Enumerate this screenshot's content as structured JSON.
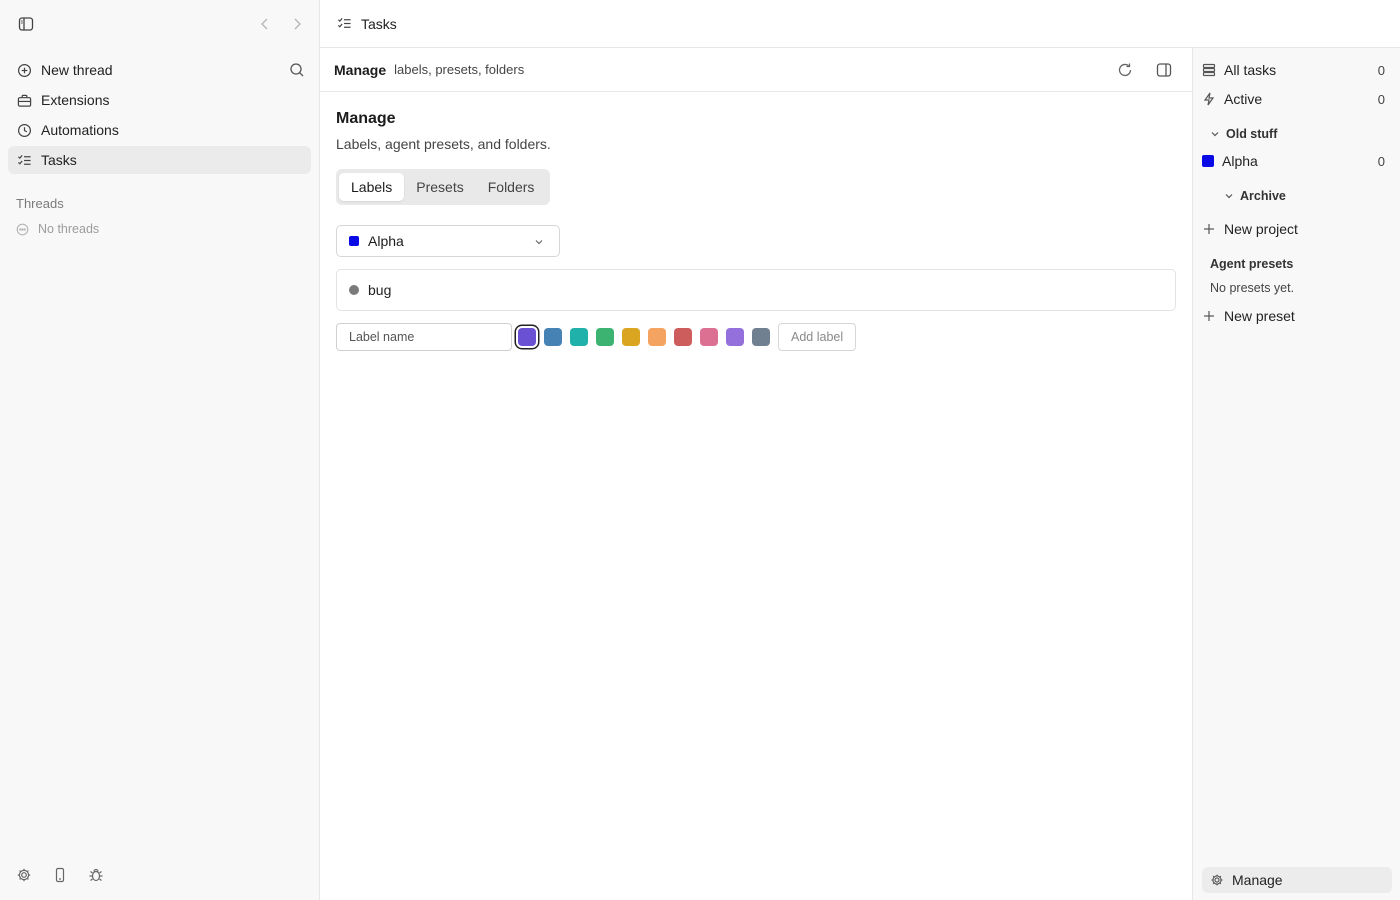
{
  "sidebar": {
    "items": [
      {
        "label": "New thread",
        "icon": "plus-circle-icon"
      },
      {
        "label": "Extensions",
        "icon": "toolbox-icon"
      },
      {
        "label": "Automations",
        "icon": "clock-icon"
      },
      {
        "label": "Tasks",
        "icon": "checklist-icon",
        "active": true
      }
    ],
    "threads_heading": "Threads",
    "threads_empty": "No threads"
  },
  "topbar": {
    "title": "Tasks"
  },
  "main": {
    "header_title": "Manage",
    "header_subtitle": "labels, presets, folders",
    "title": "Manage",
    "subtitle": "Labels, agent presets, and folders.",
    "tabs": [
      {
        "label": "Labels",
        "active": true
      },
      {
        "label": "Presets",
        "active": false
      },
      {
        "label": "Folders",
        "active": false
      }
    ],
    "project_select": {
      "value": "Alpha",
      "color": "#0a0ae6"
    },
    "labels": [
      {
        "name": "bug",
        "color": "#7a7a7a"
      }
    ],
    "new_label": {
      "placeholder": "Label name",
      "colors": [
        "#6a50d3",
        "#4682b4",
        "#20b2aa",
        "#3cb371",
        "#daa520",
        "#f4a460",
        "#cd5c5c",
        "#db7093",
        "#9370db",
        "#708090"
      ],
      "selected_color_index": 0,
      "add_button": "Add label"
    }
  },
  "right_panel": {
    "all_tasks": {
      "label": "All tasks",
      "count": "0"
    },
    "active": {
      "label": "Active",
      "count": "0"
    },
    "group_old_stuff": "Old stuff",
    "project_alpha": {
      "label": "Alpha",
      "count": "0",
      "color": "#0a0ae6"
    },
    "group_archive": "Archive",
    "new_project": "New project",
    "agent_presets_heading": "Agent presets",
    "agent_presets_empty": "No presets yet.",
    "new_preset": "New preset",
    "manage": "Manage"
  }
}
